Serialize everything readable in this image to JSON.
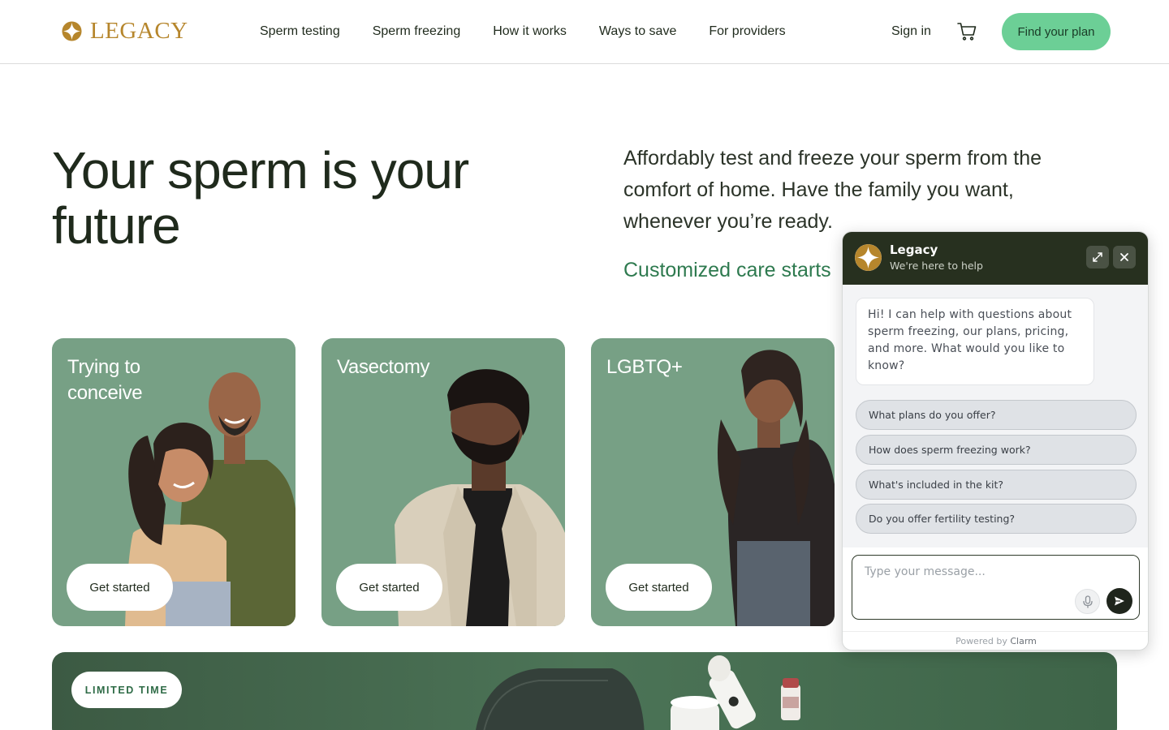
{
  "header": {
    "logo_text": "LEGACY",
    "nav": [
      "Sperm testing",
      "Sperm freezing",
      "How it works",
      "Ways to save",
      "For providers"
    ],
    "sign_in": "Sign in",
    "cta": "Find your plan"
  },
  "hero": {
    "title": "Your sperm is your future",
    "subtitle": "Affordably test and freeze your sperm from the comfort of home. Have the family you want, whenever you’re ready.",
    "link": "Customized care starts"
  },
  "cards": [
    {
      "title": "Trying to conceive",
      "button": "Get started"
    },
    {
      "title": "Vasectomy",
      "button": "Get started"
    },
    {
      "title": "LGBTQ+",
      "button": "Get started"
    }
  ],
  "promo": {
    "badge": "LIMITED TIME"
  },
  "chat": {
    "name": "Legacy",
    "status": "We're here to help",
    "greeting": "Hi! I can help with questions about sperm freezing, our plans, pricing, and more. What would you like to know?",
    "suggestions": [
      "What plans do you offer?",
      "How does sperm freezing work?",
      "What's included in the kit?",
      "Do you offer fertility testing?"
    ],
    "input_placeholder": "Type your message...",
    "powered_prefix": "Powered by",
    "powered_brand": "Clarm"
  },
  "colors": {
    "brand_gold": "#b6862c",
    "cta_green": "#6ccf96",
    "card_green": "#77a085",
    "chat_header": "#27301f",
    "link_green": "#2e7a4f"
  }
}
